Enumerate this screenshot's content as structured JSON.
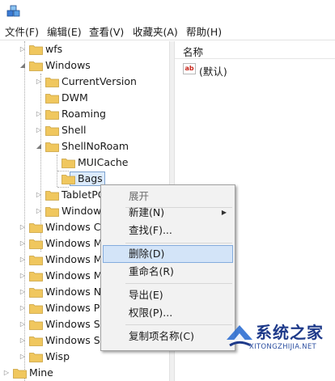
{
  "menu": [
    "文件(F)",
    "编辑(E)",
    "查看(V)",
    "收藏夹(A)",
    "帮助(H)"
  ],
  "tree": [
    {
      "label": "wfs",
      "expander": "collapsed"
    },
    {
      "label": "Windows",
      "expander": "expanded"
    },
    {
      "label": "CurrentVersion",
      "expander": "collapsed"
    },
    {
      "label": "DWM",
      "expander": "none"
    },
    {
      "label": "Roaming",
      "expander": "collapsed"
    },
    {
      "label": "Shell",
      "expander": "collapsed"
    },
    {
      "label": "ShellNoRoam",
      "expander": "expanded"
    },
    {
      "label": "MUICache",
      "expander": "none"
    },
    {
      "label": "Bags",
      "expander": "none",
      "selected": true
    },
    {
      "label": "TabletPC",
      "expander": "collapsed"
    },
    {
      "label": "Windows",
      "expander": "collapsed"
    },
    {
      "label": "Windows C",
      "expander": "collapsed"
    },
    {
      "label": "Windows M",
      "expander": "collapsed"
    },
    {
      "label": "Windows M",
      "expander": "collapsed"
    },
    {
      "label": "Windows M",
      "expander": "collapsed"
    },
    {
      "label": "Windows N",
      "expander": "collapsed"
    },
    {
      "label": "Windows P",
      "expander": "collapsed"
    },
    {
      "label": "Windows S",
      "expander": "collapsed"
    },
    {
      "label": "Windows S",
      "expander": "collapsed"
    },
    {
      "label": "Wisp",
      "expander": "collapsed"
    },
    {
      "label": "Mine",
      "expander": "collapsed"
    }
  ],
  "list": {
    "column_header": "名称",
    "values": [
      {
        "icon": "ab",
        "name": "(默认)"
      }
    ]
  },
  "context_menu": {
    "items": [
      "展开",
      "新建(N)",
      "查找(F)...",
      "删除(D)",
      "重命名(R)",
      "导出(E)",
      "权限(P)...",
      "复制项名称(C)"
    ],
    "highlighted": "删除(D)",
    "disabled": [
      "展开"
    ],
    "submenu": [
      "新建(N)"
    ]
  },
  "watermark": {
    "title": "系统之家",
    "subtitle": "XITONGZHIJIA.NET"
  },
  "colors": {
    "folder": "#f0c75e",
    "selection": "#dcebfc",
    "menu_highlight": "#d3e4f8",
    "watermark": "#1e3a8a"
  },
  "icons": {
    "app": "registry-editor-icon",
    "folder": "folder-icon",
    "value": "string-value-icon"
  }
}
